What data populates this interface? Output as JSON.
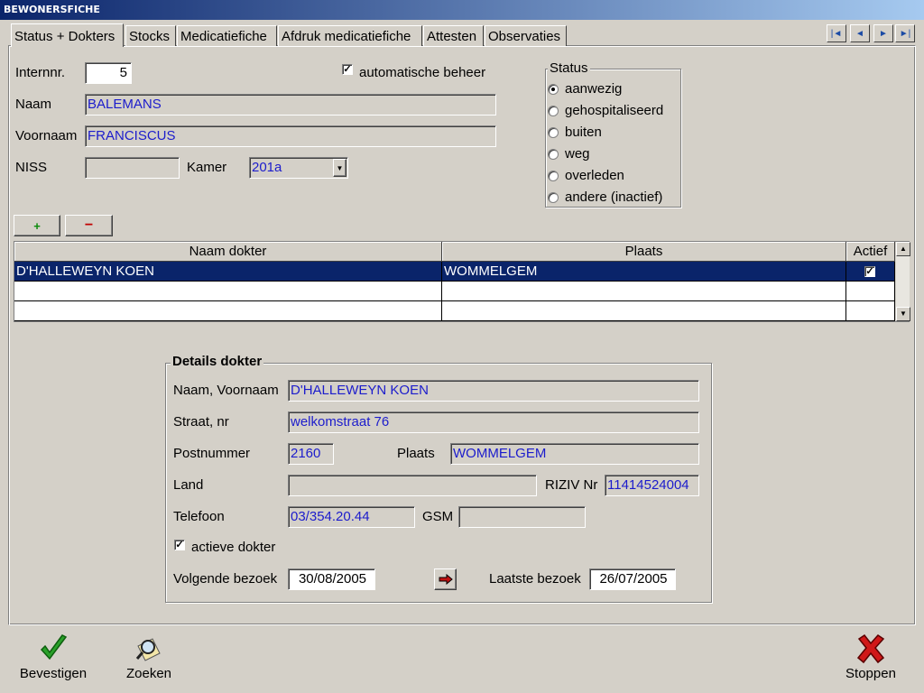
{
  "window": {
    "title": "BEWONERSFICHE"
  },
  "tabs": [
    "Status + Dokters",
    "Stocks",
    "Medicatiefiche",
    "Afdruk medicatiefiche",
    "Attesten",
    "Observaties"
  ],
  "nav": {
    "first": "|◄",
    "prev": "◄",
    "next": "►",
    "last": "►|"
  },
  "resident": {
    "internnr_label": "Internnr.",
    "internnr": "5",
    "auto_label": "automatische beheer",
    "auto_checked": "✓",
    "naam_label": "Naam",
    "naam": "BALEMANS",
    "voornaam_label": "Voornaam",
    "voornaam": "FRANCISCUS",
    "niss_label": "NISS",
    "niss": "",
    "kamer_label": "Kamer",
    "kamer": "201a"
  },
  "status": {
    "title": "Status",
    "options": [
      "aanwezig",
      "gehospitaliseerd",
      "buiten",
      "weg",
      "overleden",
      "andere (inactief)"
    ],
    "selected": "aanwezig"
  },
  "buttons": {
    "add": "+",
    "remove": "−"
  },
  "doctors_table": {
    "columns": [
      "Naam dokter",
      "Plaats",
      "Actief"
    ],
    "rows": [
      {
        "naam": "D'HALLEWEYN KOEN",
        "plaats": "WOMMELGEM",
        "actief": "✓"
      }
    ]
  },
  "details": {
    "title": "Details dokter",
    "naam_label": "Naam, Voornaam",
    "naam": "D'HALLEWEYN KOEN",
    "straat_label": "Straat, nr",
    "straat": "welkomstraat 76",
    "postnummer_label": "Postnummer",
    "postnummer": "2160",
    "plaats_label": "Plaats",
    "plaats": "WOMMELGEM",
    "land_label": "Land",
    "land": "",
    "riziv_label": "RIZIV Nr",
    "riziv": "11414524004",
    "telefoon_label": "Telefoon",
    "telefoon": "03/354.20.44",
    "gsm_label": "GSM",
    "gsm": "",
    "actief_label": "actieve dokter",
    "actief_checked": "✓",
    "volgende_label": "Volgende bezoek",
    "volgende": "30/08/2005",
    "laatste_label": "Laatste bezoek",
    "laatste": "26/07/2005"
  },
  "toolbar": {
    "confirm": "Bevestigen",
    "search": "Zoeken",
    "stop": "Stoppen"
  },
  "colors": {
    "accent": "#0a246a",
    "field_text": "#1c1ccc",
    "face": "#d4d0c8"
  },
  "icons": {
    "confirm": "checkmark-icon",
    "search": "magnifier-icon",
    "stop": "red-x-icon",
    "arrow": "right-arrow-icon"
  }
}
